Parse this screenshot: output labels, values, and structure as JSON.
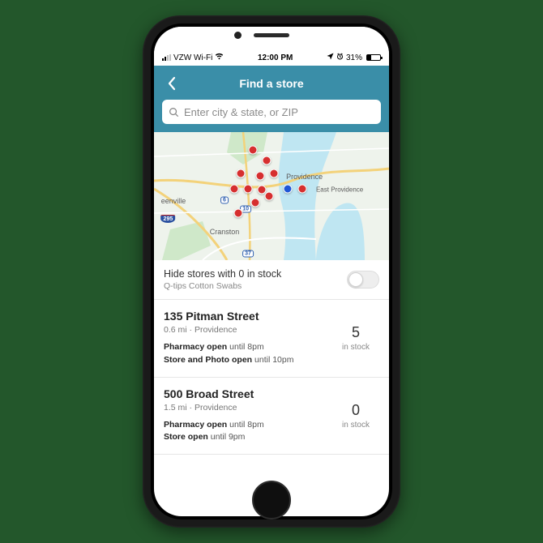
{
  "status": {
    "carrier": "VZW Wi-Fi",
    "time": "12:00 PM",
    "battery_pct": "31%"
  },
  "header": {
    "title": "Find a store"
  },
  "search": {
    "placeholder": "Enter city & state, or ZIP"
  },
  "map": {
    "labels": {
      "providence": "Providence",
      "east_providence": "East Providence",
      "cranston": "Cranston",
      "eenville": "eenville"
    },
    "routes": {
      "i295": "295",
      "us6": "6",
      "ri10": "10",
      "ri37": "37"
    }
  },
  "filter": {
    "title": "Hide stores with 0 in stock",
    "subtitle": "Q-tips Cotton Swabs"
  },
  "stock_label": "in stock",
  "stores": [
    {
      "name": "135 Pitman Street",
      "distance": "0.6 mi",
      "city": "Providence",
      "hours_line1_bold": "Pharmacy open",
      "hours_line1_rest": "until 8pm",
      "hours_line2_bold": "Store and Photo open",
      "hours_line2_rest": "until 10pm",
      "stock": "5"
    },
    {
      "name": "500 Broad Street",
      "distance": "1.5 mi",
      "city": "Providence",
      "hours_line1_bold": "Pharmacy open",
      "hours_line1_rest": "until 8pm",
      "hours_line2_bold": "Store open",
      "hours_line2_rest": "until 9pm",
      "stock": "0"
    }
  ]
}
